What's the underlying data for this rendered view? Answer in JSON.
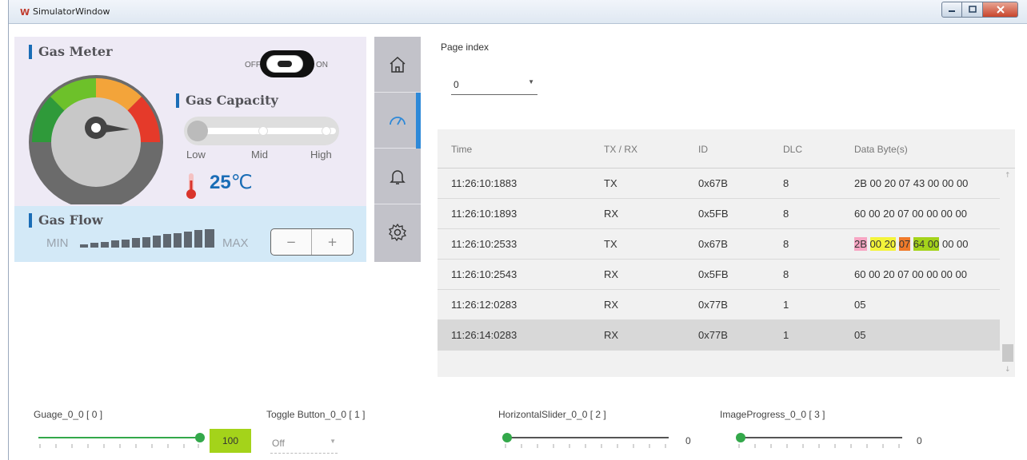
{
  "window": {
    "title": "SimulatorWindow",
    "logo_text": "W"
  },
  "gas_meter": {
    "title": "Gas Meter",
    "toggle": {
      "off_label": "OFF",
      "on_label": "ON",
      "state": "on"
    },
    "gauge_level": 0.6,
    "gauge_colors": [
      "#2f9a3a",
      "#6dc12a",
      "#f3a43a",
      "#e53a2a"
    ]
  },
  "gas_capacity": {
    "title": "Gas Capacity",
    "labels": {
      "low": "Low",
      "mid": "Mid",
      "high": "High"
    },
    "level": "Low",
    "temperature": {
      "value": "25",
      "unit": "℃"
    }
  },
  "gas_flow": {
    "title": "Gas Flow",
    "min_label": "MIN",
    "max_label": "MAX",
    "minus_label": "−",
    "plus_label": "+"
  },
  "side_nav": {
    "items": [
      {
        "name": "home-icon"
      },
      {
        "name": "gauge-icon",
        "active": true
      },
      {
        "name": "bell-icon"
      },
      {
        "name": "gear-icon"
      }
    ]
  },
  "page_index": {
    "label": "Page index",
    "value": "0"
  },
  "table": {
    "headers": [
      "Time",
      "TX / RX",
      "ID",
      "DLC",
      "Data Byte(s)"
    ],
    "rows": [
      {
        "time": "11:26:10:1883",
        "txrx": "TX",
        "id": "0x67B",
        "dlc": "8",
        "data": "2B 00 20 07 43 00 00 00"
      },
      {
        "time": "11:26:10:1893",
        "txrx": "RX",
        "id": "0x5FB",
        "dlc": "8",
        "data": "60 00 20 07 00 00 00 00"
      },
      {
        "time": "11:26:10:2533",
        "txrx": "TX",
        "id": "0x67B",
        "dlc": "8",
        "data_parts": [
          "2B",
          "00 20",
          "07",
          "64 00",
          "00 00"
        ]
      },
      {
        "time": "11:26:10:2543",
        "txrx": "RX",
        "id": "0x5FB",
        "dlc": "8",
        "data": "60 00 20 07 00 00 00 00"
      },
      {
        "time": "11:26:12:0283",
        "txrx": "RX",
        "id": "0x77B",
        "dlc": "1",
        "data": "05"
      },
      {
        "time": "11:26:14:0283",
        "txrx": "RX",
        "id": "0x77B",
        "dlc": "1",
        "data": "05",
        "selected": true
      }
    ],
    "highlight_colors": [
      "#f7a6c3",
      "#f4f43a",
      "#f07a2a",
      "#a4d31a"
    ]
  },
  "bottom": {
    "gauge": {
      "label": "Guage_0_0  [ 0 ]",
      "value": "100",
      "level": 1.0
    },
    "toggle_button": {
      "label": "Toggle Button_0_0  [ 1 ]",
      "value": "Off"
    },
    "horizontal_slider": {
      "label": "HorizontalSlider_0_0  [ 2 ]",
      "value": "0",
      "level": 0
    },
    "image_progress": {
      "label": "ImageProgress_0_0  [ 3 ]",
      "value": "0",
      "level": 0
    }
  }
}
